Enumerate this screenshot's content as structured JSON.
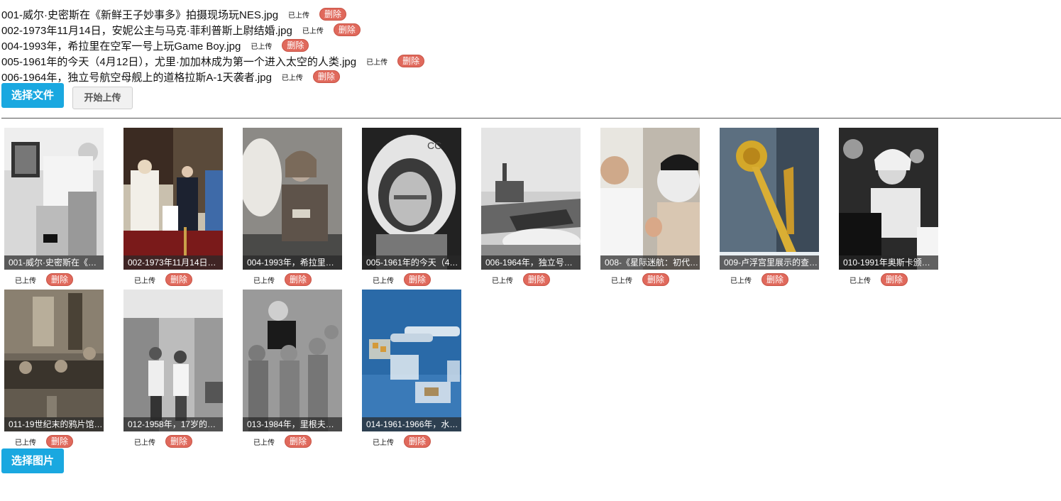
{
  "files": [
    {
      "name": "001-威尔·史密斯在《新鲜王子妙事多》拍摄现场玩NES.jpg",
      "status": "已上传",
      "delete": "删除"
    },
    {
      "name": "002-1973年11月14日，安妮公主与马克·菲利普斯上尉结婚.jpg",
      "status": "已上传",
      "delete": "删除"
    },
    {
      "name": "004-1993年，希拉里在空军一号上玩Game Boy.jpg",
      "status": "已上传",
      "delete": "删除"
    },
    {
      "name": "005-1961年的今天（4月12日），尤里·加加林成为第一个进入太空的人类.jpg",
      "status": "已上传",
      "delete": "删除"
    },
    {
      "name": "006-1964年，独立号航空母舰上的道格拉斯A-1天袭者.jpg",
      "status": "已上传",
      "delete": "删除"
    }
  ],
  "buttons": {
    "choose_file": "选择文件",
    "start_upload": "开始上传",
    "choose_image": "选择图片"
  },
  "thumbnails": [
    {
      "caption": "001-威尔·史密斯在《…",
      "status": "已上传",
      "delete": "删除"
    },
    {
      "caption": "002-1973年11月14日…",
      "status": "已上传",
      "delete": "删除"
    },
    {
      "caption": "004-1993年，希拉里…",
      "status": "已上传",
      "delete": "删除"
    },
    {
      "caption": "005-1961年的今天（4…",
      "status": "已上传",
      "delete": "删除"
    },
    {
      "caption": "006-1964年，独立号…",
      "status": "已上传",
      "delete": "删除"
    },
    {
      "caption": "008-《星际迷航：初代…",
      "status": "已上传",
      "delete": "删除"
    },
    {
      "caption": "009-卢浮宫里展示的查…",
      "status": "已上传",
      "delete": "删除"
    },
    {
      "caption": "010-1991年奥斯卡颁…",
      "status": "已上传",
      "delete": "删除"
    },
    {
      "caption": "011-19世纪末的鸦片馆…",
      "status": "已上传",
      "delete": "删除"
    },
    {
      "caption": "012-1958年，17岁的…",
      "status": "已上传",
      "delete": "删除"
    },
    {
      "caption": "013-1984年，里根夫…",
      "status": "已上传",
      "delete": "删除"
    },
    {
      "caption": "014-1961-1966年，水…",
      "status": "已上传",
      "delete": "删除"
    }
  ],
  "colors": {
    "primary_button": "#1aa8e0",
    "delete_badge": "#e0695c"
  }
}
